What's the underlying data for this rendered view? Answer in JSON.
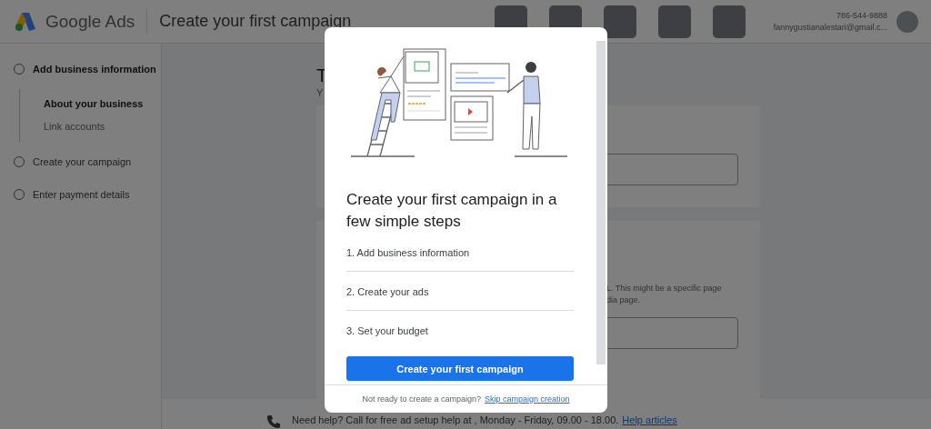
{
  "header": {
    "product": "Google Ads",
    "title": "Create your first campaign",
    "account": {
      "phone": "786-544-9888",
      "email": "fannygustianalestari@gmail.c..."
    }
  },
  "sidebar": {
    "steps": [
      {
        "label": "Add business information",
        "selected": true,
        "children": [
          {
            "label": "About your business",
            "selected": true
          },
          {
            "label": "Link accounts",
            "selected": false
          }
        ]
      },
      {
        "label": "Create your campaign",
        "selected": false
      },
      {
        "label": "Enter payment details",
        "selected": false
      }
    ]
  },
  "main": {
    "heading": "T",
    "subheading": "Y",
    "cards": [
      {
        "kind": "field"
      },
      {
        "kind": "described_field",
        "description_lines": [
          "L. This might be a specific page",
          "dia page."
        ]
      }
    ]
  },
  "help_bar": {
    "text": "Need help? Call for free ad setup help at , Monday - Friday, 09.00 - 18.00.",
    "link": "Help articles"
  },
  "dialog": {
    "title": "Create your first campaign in a few simple steps",
    "steps": [
      "1. Add business information",
      "2. Create your ads",
      "3. Set your budget"
    ],
    "primary_button": "Create your first campaign",
    "footer_text": "Not ready to create a campaign?",
    "footer_link": "Skip campaign creation"
  }
}
